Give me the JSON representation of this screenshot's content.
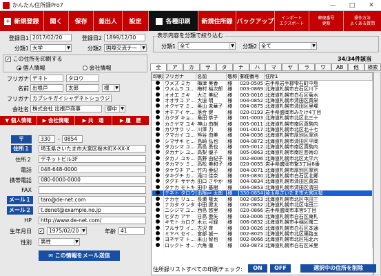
{
  "window": {
    "title": "かんたん住所録Pro7",
    "min": "—",
    "max": "□",
    "close": "✕"
  },
  "toolbar": {
    "new": "新規登録",
    "open": "開く",
    "save": "保存",
    "sender": "差出人",
    "settings": "設定",
    "print": "各種印刷",
    "new_addressbook": "新規住所録",
    "backup": "バックアップ",
    "import1": "インポート",
    "import2": "エクスポート",
    "postal1": "郵便番号",
    "postal2": "更新",
    "help1": "操作方法",
    "help2": "よくある質問"
  },
  "form": {
    "reg1_label": "登録日1",
    "reg1_value": "2017/02/20",
    "reg2_label": "登録日2",
    "reg2_value": "1899/12/30",
    "cat1_label": "分類1",
    "cat1_value": "大学",
    "cat2_label": "分類2",
    "cat2_value": "国際交流チー",
    "print_check": "この住所を印刷する",
    "print_checked": "✓",
    "personal": "個人情報",
    "company": "会社情報",
    "furigana_label": "フリガナ",
    "furigana_last": "デネト",
    "furigana_first": "タロウ",
    "name_label": "名前",
    "name_last": "出根戸",
    "name_first": "太郎",
    "honorific": "様",
    "furigana2_label": "フリガナ",
    "furigana2_value": "カブシキガイシャデネトショウジ",
    "company_label": "会社名",
    "company_value": "株式会社 出根戸商事",
    "company_honorific": "御中"
  },
  "tabs": {
    "personal": "▼ 個人情報",
    "company": "▶ 会社情報",
    "common": "▶ 共　通",
    "history": "▶ 履　歴"
  },
  "detail": {
    "zip_label": "〒",
    "zip1": "330",
    "zip2": "0854",
    "addr1_label": "住所１",
    "addr1_value": "埼玉県さいたま市大宮区桜木町X-XX-X",
    "addr2_label": "住所２",
    "addr2_value": "デネットビル3F",
    "tel_label": "電話",
    "tel_value": "048-648-0000",
    "mobile_label": "携帯電話",
    "mobile_value": "080-0000-0000",
    "fax_label": "FAX",
    "fax_value": "",
    "mail1_label": "メール１",
    "mail1_value": "taro@de-net.com",
    "mail2_label": "メール２",
    "mail2_value": "t.denet@example.ne.jp",
    "hp_label": "HP",
    "hp_value": "http://www.de-net.com/",
    "birth_label": "生年月日",
    "birth_value": "1975/02/20",
    "age_label": "年齢",
    "age_value": "41",
    "sex_label": "性別",
    "sex_value": "男性",
    "send_mail": "この情報をメール送信"
  },
  "filter": {
    "legend": "表示内容を分類で絞り込む",
    "cat1_label": "分類1",
    "cat1_value": "全て",
    "cat2_label": "分類2",
    "cat2_value": "全て",
    "count": "34/34件該当"
  },
  "kana": [
    "全",
    "ア",
    "カ",
    "サ",
    "タ",
    "ナ",
    "ハ",
    "マ",
    "ヤ",
    "ラ",
    "ワ",
    "AB",
    "他",
    "検索"
  ],
  "table": {
    "headers": [
      "印刷",
      "フリガナ",
      "名前",
      "敬称",
      "郵便番号",
      "住所1"
    ],
    "rows": [
      [
        "●",
        "ウメズ ミカ",
        "梅津 美香",
        "様",
        "020-0505",
        "岩手県岩手郡雫石町中島"
      ],
      [
        "●",
        "ウメムラ ユ...",
        "梅村 裕次郎",
        "様",
        "003-0869",
        "北海道札幌市白石区川下"
      ],
      [
        "●",
        "オオエ ミキ",
        "大江 美紀",
        "様",
        "003-0016",
        "北海道札幌市白石区菊水"
      ],
      [
        "●",
        "オオサコ ア...",
        "大迫 明",
        "様",
        "004-0852",
        "北海道札幌市清田区真栄"
      ],
      [
        "●",
        "オクヤマ ミ...",
        "奥山 未華子",
        "様",
        "004-0875",
        "北海道札幌市清田区里塚"
      ],
      [
        "●",
        "オチアイ ケ...",
        "落合 健",
        "様",
        "020-0193",
        "岩手県盛岡市みたけ4丁目"
      ],
      [
        "●",
        "カクダ キョ...",
        "角田 恭子",
        "様",
        "001-0003",
        "北海道札幌市北区北三十"
      ],
      [
        "●",
        "カミヤマ ユキ",
        "神山 由樹",
        "様",
        "005-0011",
        "北海道札幌市南区真駒内"
      ],
      [
        "●",
        "カワサワ リ...",
        "川澤 力",
        "様",
        "001-0017",
        "北海道札幌市北区北十七"
      ],
      [
        "●",
        "クマガイ ユ...",
        "熊谷 由美",
        "様",
        "004-0036",
        "北海道札幌市厚別区厚別"
      ],
      [
        "●",
        "シマザキ ヒ...",
        "島崎 弘也",
        "様",
        "004-0872",
        "北海道札幌市清田区平岡"
      ],
      [
        "●",
        "タカシマ ユ...",
        "高島 勇也",
        "様",
        "005-0012",
        "北海道札幌市南区真駒内"
      ],
      [
        "●",
        "タカナシ ユ...",
        "高梨 優子",
        "様",
        "005-0863",
        "北海道札幌市南区芸術の"
      ],
      [
        "●",
        "タカノ ユキ...",
        "高野 由紀子",
        "様",
        "002-8006",
        "北海道札幌市北区太平六"
      ],
      [
        "●",
        "タカマツ ミ...",
        "高松 美和子",
        "様",
        "020-0055",
        "岩手県盛岡市繋3丁目8番"
      ],
      [
        "●",
        "タケウチ ア...",
        "竹内 亜紀",
        "様",
        "004-0071",
        "北海道札幌市厚別区厚別"
      ],
      [
        "●",
        "タキグチ カ...",
        "滝口 佳奈",
        "様",
        "003-0830",
        "北海道札幌市白石区北郷"
      ],
      [
        "●",
        "タグチ サヤカ",
        "田口 さやか",
        "様",
        "004-0834",
        "北海道札幌市清田区真栄"
      ],
      [
        "●",
        "タナカ モトキ",
        "田中 基樹",
        "様",
        "004-0853",
        "北海道札幌市清田区清田"
      ],
      [
        "●",
        "デネト タロウ",
        "出根戸 太郎",
        "様",
        "330-0854",
        "埼玉県さいたま市大宮区桜"
      ],
      [
        "●",
        "ナカセ リュ...",
        "長瀬 隆太",
        "様",
        "002-0853",
        "北海道札幌市北区屯田三"
      ],
      [
        "●",
        "ナカタ ケンタ",
        "中田 健太",
        "様",
        "002-0852",
        "北海道札幌市北区屯田二"
      ],
      [
        "●",
        "ニシジマ ユ...",
        "西島 悠里",
        "様",
        "020-0866",
        "岩手県盛岡市本宮5丁目"
      ],
      [
        "●",
        "ヒダカ アヤ",
        "日高 亜矢",
        "様",
        "003-0006",
        "北海道札幌市白石区東札"
      ],
      [
        "●",
        "キモト カロク",
        "木元 可録",
        "様",
        "006-0832",
        "北海道札幌市手稲区曙二"
      ],
      [
        "●",
        "フルサワ イ...",
        "古沢 育",
        "様",
        "003-0026",
        "北海道札幌市白石区本通"
      ],
      [
        "●",
        "ミヤベ セイ...",
        "宮部 誠一",
        "様",
        "002-8025",
        "北海道札幌市北区篠路五"
      ],
      [
        "●",
        "ヨネヤマ ト...",
        "米山 智也",
        "様",
        "002-8066",
        "北海道札幌市北区拓北六"
      ],
      [
        "●",
        "ロックト オ...",
        "六角 徹",
        "様",
        "003-0873",
        "北海道札幌市白石区米里"
      ]
    ]
  },
  "bottom": {
    "label": "住所録リストすべての印刷チェック:",
    "on": "ON",
    "off": "OFF",
    "delete": "選択中の住所を削除"
  },
  "colors": {
    "brand": "#c40000",
    "blue": "#1a4fa0",
    "select": "#1a5fd0"
  }
}
